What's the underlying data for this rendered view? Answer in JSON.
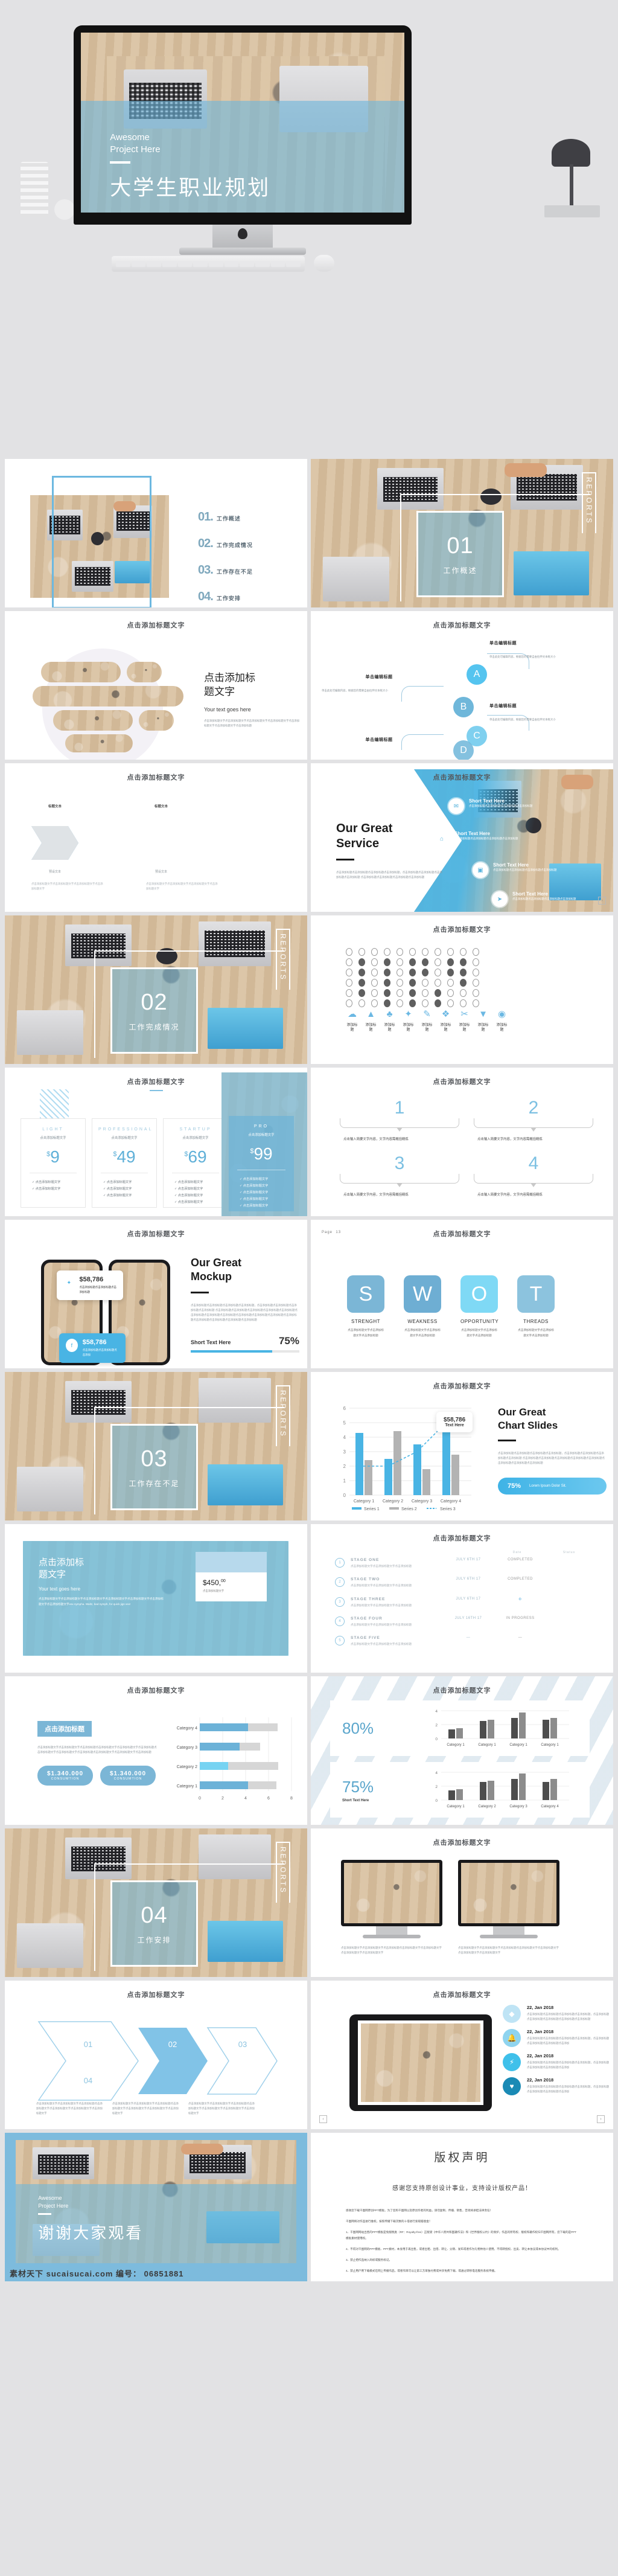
{
  "hero": {
    "subtitle_line1": "Awesome",
    "subtitle_line2": "Project Here",
    "title": "大学生职业规划"
  },
  "common": {
    "click_title": "点击添加标题文字",
    "click_title_short": "点击添加标题",
    "lorem_cn": "点击添加标题文字点击添加标题文字点击添加标题点击添加标题文字点击添加标题文字点击添加标题文字点击添加标题文字",
    "lorem_cn_short": "点击添加标题点击添加标题点击添加标题点击添加标题，点击添加标题点击添加标题点击添加标题 点击添加标题点击添加标题点击添加标题点击添加标题",
    "edit_title": "单击编辑标题",
    "edit_body": "单击此处可编辑内容，根据您的需要自由拉伸文本框大小",
    "add_title": "添加标题",
    "short_text_here": "Short Text Here",
    "your_text": "Your text goes here",
    "reports": "REPORTS"
  },
  "toc": {
    "items": [
      {
        "num": "01.",
        "label": "工作概述"
      },
      {
        "num": "02.",
        "label": "工作完成情况"
      },
      {
        "num": "03.",
        "label": "工作存在不足"
      },
      {
        "num": "04.",
        "label": "工作安排"
      }
    ]
  },
  "sections": [
    {
      "num": "01",
      "label": "工作概述"
    },
    {
      "num": "02",
      "label": "工作完成情况"
    },
    {
      "num": "03",
      "label": "工作存在不足"
    },
    {
      "num": "04",
      "label": "工作安排"
    }
  ],
  "slide_pill": {
    "heading_line1": "点击添加标",
    "heading_line2": "题文字",
    "your_text": "Your text goes here",
    "body": "点击添加标题文字点击添加标题文字点击添加标题文字点击添加标题文字点击添加标题文字点击添加标题文字点击添加标题"
  },
  "abcd": {
    "nodes": [
      {
        "letter": "A",
        "title": "单击编辑标题",
        "body": "单击此处可编辑内容，根据您的需要自由拉伸文本框大小"
      },
      {
        "letter": "B",
        "title": "单击编辑标题",
        "body": "单击此处可编辑内容，根据您的需要自由拉伸文本框大小"
      },
      {
        "letter": "C",
        "title": "单击编辑标题",
        "body": "单击此处可编辑内容，根据您的需要自由拉伸文本框大小"
      },
      {
        "letter": "D",
        "title": "单击编辑标题",
        "body": "单击此处可编辑内容，根据您的需要自由拉伸文本框大小"
      }
    ]
  },
  "chevrons": {
    "items": [
      {
        "title": "标题文本",
        "sub": "预设文本"
      },
      {
        "title": "标题文本",
        "sub": "预设文本"
      },
      {
        "title": "标题文本",
        "sub": "预设文本"
      },
      {
        "title": "标题文本",
        "sub": "预设文本"
      }
    ],
    "body": "点击添加标题文字点击添加标题文字点击添加标题文字点击添加标题文字"
  },
  "service": {
    "heading_line1": "Our Great",
    "heading_line2": "Service",
    "body": "点击添加标题点击添加标题点击添加标题点击添加标题，点击添加标题点击添加标题点击添加标题点击添加标题 点击添加标题点击添加标题点击添加标题点击添加标题",
    "items": [
      {
        "icon": "chat-icon",
        "title": "Short Text Here",
        "body": "点击添加标题点击添加标题点击添加标题点击添加标题"
      },
      {
        "icon": "home-icon",
        "title": "Short Text Here",
        "body": "点击添加标题点击添加标题点击添加标题点击添加标题"
      },
      {
        "icon": "briefcase-icon",
        "title": "Short Text Here",
        "body": "点击添加标题点击添加标题点击添加标题点击添加标题"
      },
      {
        "icon": "send-icon",
        "title": "Short Text Here",
        "body": "点击添加标题点击添加标题点击添加标题点击添加标题"
      }
    ]
  },
  "icon_row": {
    "icons": [
      "cloud-icon",
      "chart-icon",
      "suit-icon",
      "bulb-icon",
      "pen-icon",
      "shirt-icon",
      "scissors-icon",
      "tie-icon",
      "eye-icon"
    ],
    "labels": [
      "添加标题",
      "添加标题",
      "添加标题",
      "添加标题",
      "添加标题",
      "添加标题",
      "添加标题",
      "添加标题",
      "添加标题"
    ]
  },
  "pricing": {
    "plans": [
      {
        "tier": "LIGHT",
        "sub": "点击添加标题文字",
        "currency": "$",
        "amount": "9",
        "features": [
          "点击添加标题文字",
          "点击添加标题文字"
        ]
      },
      {
        "tier": "PROFESSIONAL",
        "sub": "点击添加标题文字",
        "currency": "$",
        "amount": "49",
        "features": [
          "点击添加标题文字",
          "点击添加标题文字",
          "点击添加标题文字"
        ]
      },
      {
        "tier": "STARTUP",
        "sub": "点击添加标题文字",
        "currency": "$",
        "amount": "69",
        "features": [
          "点击添加标题文字",
          "点击添加标题文字",
          "点击添加标题文字",
          "点击添加标题文字"
        ]
      },
      {
        "tier": "PRO",
        "sub": "点击添加标题文字",
        "currency": "$",
        "amount": "99",
        "features": [
          "点击添加标题文字",
          "点击添加标题文字",
          "点击添加标题文字",
          "点击添加标题文字",
          "点击添加标题文字"
        ]
      }
    ]
  },
  "quad": {
    "items": [
      {
        "num": "1",
        "text": "点击输入简要文字内容，文字内容需概括精炼"
      },
      {
        "num": "2",
        "text": "点击输入简要文字内容，文字内容需概括精炼"
      },
      {
        "num": "3",
        "text": "点击输入简要文字内容，文字内容需概括精炼"
      },
      {
        "num": "4",
        "text": "点击输入简要文字内容，文字内容需概括精炼"
      }
    ]
  },
  "mockup": {
    "heading_line1": "Our Great",
    "heading_line2": "Mockup",
    "body": "点击添加标题点击添加标题点击添加标题点击添加标题，点击添加标题点击添加标题点击添加标题点击添加标题 点击添加标题点击添加标题点击添加标题点击添加标题点击添加标题点击添加标题点击添加标题点击添加标题点击添加标题点击添加标题点击添加标题点击添加标题点击添加标题点击添加标题点击添加标题点击添加标题",
    "bubbles": [
      {
        "icon": "twitter-icon",
        "amount": "$58,786",
        "text": "点击添加标题点击添加标题点击添加标题"
      },
      {
        "icon": "facebook-icon",
        "amount": "$58,786",
        "text": "点击添加标题点击添加标题点击添加"
      }
    ],
    "progress_label": "Short Text Here",
    "progress_value": "75%"
  },
  "swot": {
    "page_label": "Page",
    "page_number": "13",
    "items": [
      {
        "letter": "S",
        "label": "STRENGHT",
        "text": "点击添加标题文字点击添加标题文字点击添加标题",
        "color": "#7bb6d6"
      },
      {
        "letter": "W",
        "label": "WEAKNESS",
        "text": "点击添加标题文字点击添加标题文字点击添加标题",
        "color": "#6eaed3"
      },
      {
        "letter": "O",
        "label": "OPPORTUNITY",
        "text": "点击添加标题文字点击添加标题文字点击添加标题",
        "color": "#7fd9f5"
      },
      {
        "letter": "T",
        "label": "THREADS",
        "text": "点击添加标题文字点击添加标题文字点击添加标题",
        "color": "#8cc3de"
      }
    ]
  },
  "chart_slide": {
    "heading_line1": "Our Great",
    "heading_line2": "Chart Slides",
    "body": "点击添加标题点击添加标题点击添加标题点击添加标题，点击添加标题点击添加标题点击添加标题点击添加标题 点击添加标题点击添加标题点击添加标题点击添加标题点击添加标题点击添加标题点击添加标题点击添加标题",
    "callout_amount": "$58,786",
    "callout_text": "Text Here",
    "badge_pct": "75%",
    "badge_text": "Lorem Ipsum Dolor Sit."
  },
  "pricecard": {
    "heading_line1": "点击添加标",
    "heading_line2": "题文字",
    "your_text": "Your text goes here",
    "body": "点击添加标题文字点击添加标题文字点击添加标题文字点击添加标题文字点击添加标题文字点击添加标题文字点击添加标题文字vex nympha. Waltz, bad nymph, for quick jigs vex!",
    "price": "$450,",
    "price_cents": "00",
    "price_sub": "点击添加标题文字"
  },
  "stages": {
    "col_header_date": "Date",
    "col_header_status": "Status",
    "rows": [
      {
        "n": "1",
        "name": "STAGE ONE",
        "desc": "点击添加标题文字点击添加标题文字点击添加标题",
        "date": "JULY 6TH 17",
        "status": "COMPLETED"
      },
      {
        "n": "2",
        "name": "STAGE TWO",
        "desc": "点击添加标题文字点击添加标题文字点击添加标题",
        "date": "JULY 6TH 17",
        "status": "COMPLETED"
      },
      {
        "n": "3",
        "name": "STAGE THREE",
        "desc": "点击添加标题文字点击添加标题文字点击添加标题",
        "date": "JULY 6TH 17",
        "status": "IN PROGRESS"
      },
      {
        "n": "4",
        "name": "STAGE FOUR",
        "desc": "点击添加标题文字点击添加标题文字点击添加标题",
        "date": "JULY 16TH 17",
        "status": "IN PROGRESS"
      },
      {
        "n": "5",
        "name": "STAGE FIVE",
        "desc": "点击添加标题文字点击添加标题文字点击添加标题",
        "date": "—",
        "status": "—"
      }
    ]
  },
  "hbar_slide": {
    "badge": "点击添加标题",
    "body": "点击添加标题文字点击添加标题文字点击添加标题点击添加标题文字点击添加标题文字点击添加标题点击添加标题文字点击添加标题文字点击添加标题点击添加标题文字点击添加标题文字点击添加标题",
    "stats": [
      {
        "value": "$1.340.000",
        "label": "CONSUMTION"
      },
      {
        "value": "$1.340.000",
        "label": "CONSUMTION"
      }
    ]
  },
  "pct_slide": {
    "pct_top": "80%",
    "pct_bottom": "75%",
    "bottom_label": "Short Text Here"
  },
  "timeline": {
    "items": [
      {
        "icon": "diamond-icon",
        "date": "22, Jan 2018",
        "text": "点击添加标题点击添加标题点击添加标题点击添加标题，点击添加标题点击添加标题点击添加标题点击添加标题点击添加标题",
        "color": "#bfe4f5"
      },
      {
        "icon": "bell-icon",
        "date": "22, Jan 2018",
        "text": "点击添加标题点击添加标题点击添加标题点击添加标题，点击添加标题点击添加标题点击添加标题点击添加",
        "color": "#8fd4ef"
      },
      {
        "icon": "bolt-icon",
        "date": "22, Jan 2018",
        "text": "点击添加标题点击添加标题点击添加标题点击添加标题，点击添加标题点击添加标题点击添加标题点击添加",
        "color": "#3fc0ea"
      },
      {
        "icon": "heart-icon",
        "date": "22, Jan 2018",
        "text": "点击添加标题点击添加标题点击添加标题点击添加标题，点击添加标题点击添加标题点击添加标题点击添加",
        "color": "#1a8ab5"
      }
    ],
    "prev": "‹",
    "next": "›"
  },
  "thanks": {
    "subtitle_line1": "Awesome",
    "subtitle_line2": "Project Here",
    "title": "谢谢大家观看"
  },
  "watermark": "素材天下 sucaisucai.com  编号： 06851881",
  "copyright": {
    "title": "版权声明",
    "subtitle": "感谢您支持原创设计事业，支持设计版权产品！",
    "paragraphs": [
      "感谢您下载千图网原创PPT模板，为了您和千图网以及原创作者的利益，请勿复制、传播、销售，否则将承担法律责任！",
      "千图网将对作品进行维权，按照传播下载次数的十倍进行索取赔偿金！",
      "1、千图网网站出售的PPT模板是免版税类（RF：Royalty-free）正版受《中华人民共和国著作法》和《世界版权公约》的保护，作品的所有权、版权和著作权归千图网所有，您下载的是PPT模板素材使用权。",
      "2、不得对千图网的PPT模板、PPT素材，本身用于再出售，或者出租、出借、转让、分销、发布或者作为礼物供他人使用，不得转授权、出卖、转让本协议或本协议中的权利。",
      "3、禁止把作品纳入商标或服务标记。",
      "4、禁止用户用下载模式在网上传播作品，或者作目可以让第三方单独付费或共享免费下载、或通过转移电话服务系统传播。"
    ]
  },
  "colors": {
    "accent": "#49b4e4",
    "accent_light": "#8fc4e2",
    "accent_dark": "#1a8ab5",
    "grey": "#b3b3b3",
    "page_bg": "#e2e2e4"
  },
  "chart_data": [
    {
      "id": "great_chart",
      "type": "bar",
      "title": "Our Great Chart Slides",
      "categories": [
        "Category 1",
        "Category 2",
        "Category 3",
        "Category 4"
      ],
      "series": [
        {
          "name": "Series 1",
          "values": [
            4.3,
            2.5,
            3.5,
            4.5
          ],
          "color": "#49b4e4",
          "kind": "bar"
        },
        {
          "name": "Series 2",
          "values": [
            2.4,
            4.4,
            1.8,
            2.8
          ],
          "color": "#b3b3b3",
          "kind": "bar"
        },
        {
          "name": "Series 3",
          "values": [
            2.0,
            2.0,
            3.0,
            5.0
          ],
          "color": "#49b4e4",
          "kind": "dashed-line"
        }
      ],
      "ylim": [
        0,
        6
      ],
      "yticks": [
        0,
        1,
        2,
        3,
        4,
        5,
        6
      ],
      "legend": "bottom",
      "grid": true,
      "annotation": {
        "amount": "$58,786",
        "text": "Text Here"
      }
    },
    {
      "id": "hbar_stacked",
      "type": "bar",
      "orientation": "horizontal",
      "categories": [
        "Category 1",
        "Category 2",
        "Category 3",
        "Category 4"
      ],
      "series": [
        {
          "name": "Value",
          "values": [
            4.2,
            2.5,
            3.5,
            4.4
          ],
          "color": "#6cb2d8"
        },
        {
          "name": "Remainder",
          "values": [
            2.6,
            4.4,
            1.8,
            2.8
          ],
          "color": "#d6d6d6"
        }
      ],
      "xlim": [
        0,
        8
      ],
      "xticks": [
        0,
        2,
        4,
        6,
        8
      ],
      "grid": true
    },
    {
      "id": "dark_bars_top",
      "type": "bar",
      "categories": [
        "Category 1",
        "Category 1",
        "Category 1",
        "Category 1"
      ],
      "series": [
        {
          "name": "Series 1",
          "values": [
            1.3,
            2.55,
            3.0,
            2.7
          ],
          "color": "#4d4d4d"
        },
        {
          "name": "Series 2",
          "values": [
            1.5,
            2.7,
            3.75,
            3.0
          ],
          "color": "#8c8c8c"
        }
      ],
      "ylim": [
        0,
        4
      ],
      "yticks": [
        0,
        2,
        4
      ],
      "grid": true
    },
    {
      "id": "dark_bars_bottom",
      "type": "bar",
      "categories": [
        "Category 1",
        "Category 2",
        "Category 3",
        "Category 4"
      ],
      "series": [
        {
          "name": "Series 1",
          "values": [
            1.4,
            2.6,
            3.1,
            2.6
          ],
          "color": "#4d4d4d"
        },
        {
          "name": "Series 2",
          "values": [
            1.6,
            2.8,
            3.8,
            3.1
          ],
          "color": "#8c8c8c"
        }
      ],
      "ylim": [
        0,
        4
      ],
      "yticks": [
        0,
        2,
        4
      ],
      "grid": true
    }
  ]
}
